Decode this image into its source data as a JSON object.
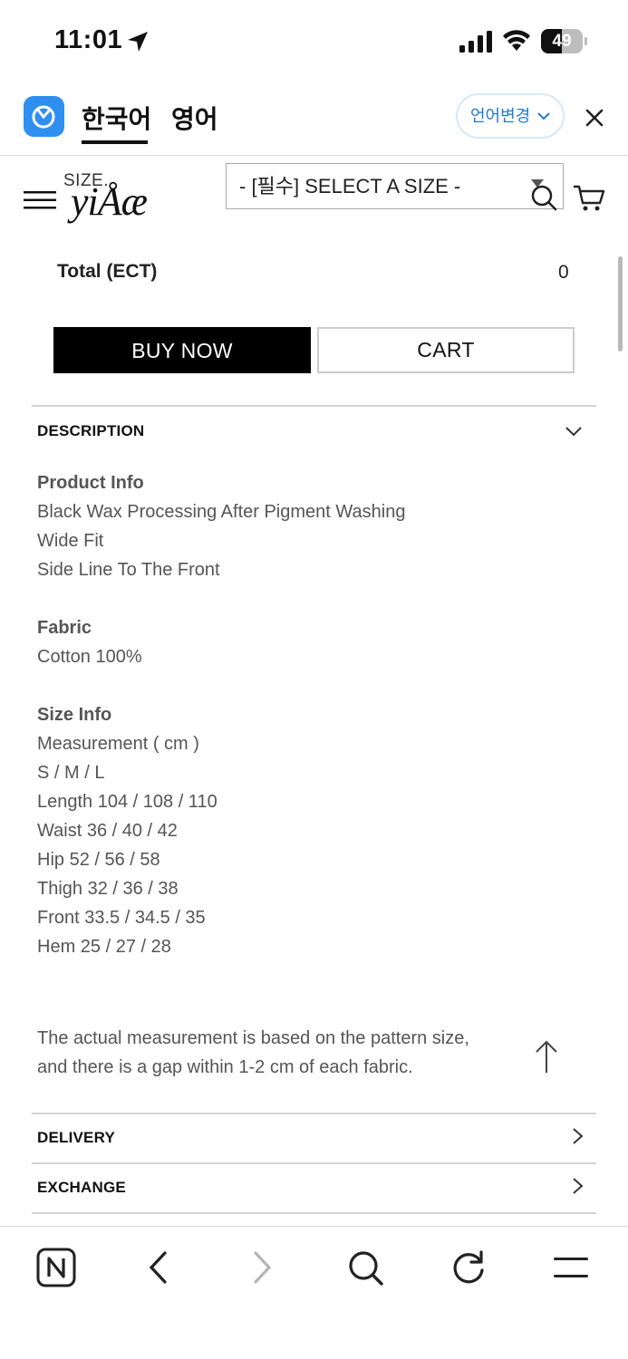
{
  "status_bar": {
    "time": "11:01",
    "battery_level": "49",
    "battery_fraction": 0.49
  },
  "translate_bar": {
    "tab_korean": "한국어",
    "tab_english": "영어",
    "active_tab": "한국어",
    "language_change_label": "언어변경"
  },
  "header": {
    "logo_size": "SIZE.",
    "logo_name": "yiÅæ",
    "size_select_value": "- [필수] SELECT A SIZE -"
  },
  "order": {
    "total_label": "Total (ECT)",
    "total_value": "0",
    "buy_now_label": "BUY NOW",
    "cart_label": "CART"
  },
  "description": {
    "title": "DESCRIPTION",
    "expanded": true,
    "lines": [
      {
        "text": "Product Info",
        "heading": true
      },
      {
        "text": "Black Wax Processing After Pigment Washing",
        "heading": false
      },
      {
        "text": "Wide Fit",
        "heading": false
      },
      {
        "text": "Side Line To The Front",
        "heading": false
      },
      {
        "text": "Fabric",
        "heading": true
      },
      {
        "text": "Cotton 100%",
        "heading": false
      },
      {
        "text": "Size Info",
        "heading": true
      },
      {
        "text": "Measurement ( cm )",
        "heading": false
      },
      {
        "text": "S / M / L",
        "heading": false
      },
      {
        "text": "Length 104 / 108 / 110",
        "heading": false
      },
      {
        "text": "Waist 36 / 40 / 42",
        "heading": false
      },
      {
        "text": "Hip 52 / 56 / 58",
        "heading": false
      },
      {
        "text": "Thigh 32 / 36 / 38",
        "heading": false
      },
      {
        "text": "Front 33.5 / 34.5 / 35",
        "heading": false
      },
      {
        "text": "Hem 25 / 27 / 28",
        "heading": false
      }
    ],
    "note_line_1": "The actual measurement is based on the pattern size,",
    "note_line_2": "and there is a gap within 1-2 cm of each fabric."
  },
  "delivery": {
    "title": "DELIVERY"
  },
  "exchange": {
    "title": "EXCHANGE"
  },
  "bottom_bar": {
    "icons": [
      "naver-home-icon",
      "back-icon",
      "forward-icon",
      "search-icon",
      "refresh-icon",
      "menu-icon"
    ]
  },
  "colors": {
    "accent_blue": "#1f7bd1",
    "papago_blue": "#2f8ff0",
    "buy_button_bg": "#000000",
    "body_text": "#555555"
  }
}
